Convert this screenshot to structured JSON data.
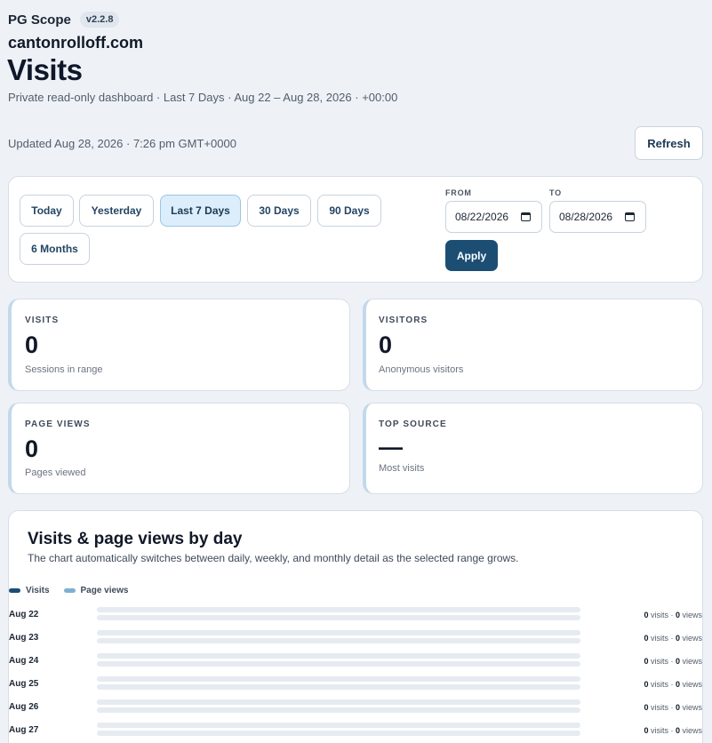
{
  "header": {
    "brand": "PG Scope",
    "version": "v2.2.8",
    "site": "cantonrolloff.com",
    "title": "Visits",
    "subtitle": "Private read-only dashboard · Last 7 Days · Aug 22 – Aug 28, 2026 · +00:00",
    "updated": "Updated Aug 28, 2026 · 7:26 pm GMT+0000",
    "refresh_label": "Refresh"
  },
  "filters": {
    "ranges": [
      {
        "label": "Today",
        "active": false
      },
      {
        "label": "Yesterday",
        "active": false
      },
      {
        "label": "Last 7 Days",
        "active": true
      },
      {
        "label": "30 Days",
        "active": false
      },
      {
        "label": "90 Days",
        "active": false
      },
      {
        "label": "6 Months",
        "active": false
      }
    ],
    "from_label": "FROM",
    "to_label": "TO",
    "from_value": "08/22/2026",
    "to_value": "08/28/2026",
    "apply_label": "Apply"
  },
  "stats": {
    "visits": {
      "label": "VISITS",
      "value": "0",
      "desc": "Sessions in range"
    },
    "visitors": {
      "label": "VISITORS",
      "value": "0",
      "desc": "Anonymous visitors"
    },
    "page_views": {
      "label": "PAGE VIEWS",
      "value": "0",
      "desc": "Pages viewed"
    },
    "top_source": {
      "label": "TOP SOURCE",
      "value": "—",
      "desc": "Most visits"
    }
  },
  "chart": {
    "title": "Visits & page views by day",
    "subtitle": "The chart automatically switches between daily, weekly, and monthly detail as the selected range grows.",
    "legend": [
      {
        "name": "Visits",
        "color": "#1c4e74"
      },
      {
        "name": "Page views",
        "color": "#7fb0d3"
      }
    ],
    "colors": {
      "visits": "#1c4e74",
      "page_views": "#7fb0d3",
      "track": "#e6ebf1"
    }
  },
  "chart_data": {
    "type": "bar",
    "orientation": "horizontal",
    "categories": [
      "Aug 22",
      "Aug 23",
      "Aug 24",
      "Aug 25",
      "Aug 26",
      "Aug 27"
    ],
    "series": [
      {
        "name": "Visits",
        "values": [
          0,
          0,
          0,
          0,
          0,
          0
        ]
      },
      {
        "name": "Page views",
        "values": [
          0,
          0,
          0,
          0,
          0,
          0
        ]
      }
    ],
    "title": "Visits & page views by day",
    "legend_position": "top-left",
    "value_text": {
      "visits_unit": "visits",
      "views_unit": "views",
      "separator": " · "
    }
  }
}
